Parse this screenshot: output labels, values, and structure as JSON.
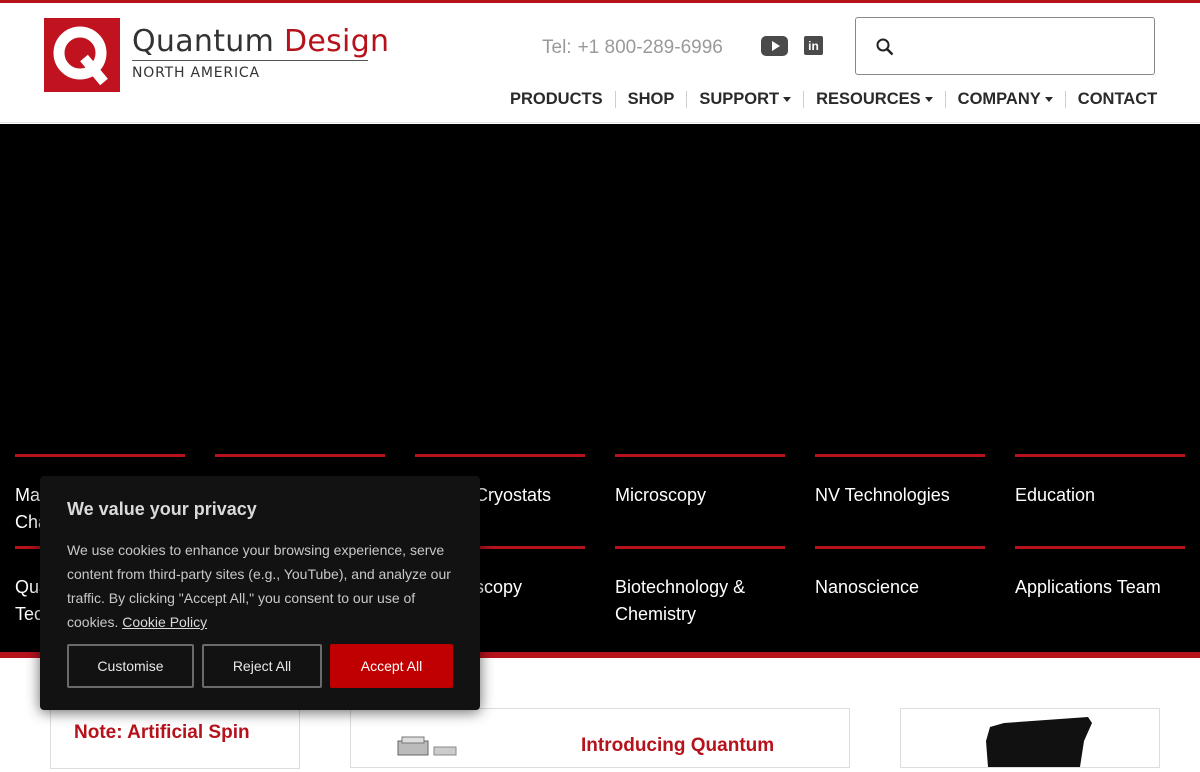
{
  "brand": {
    "name_part1": "Quantum",
    "name_part2": "Design",
    "region": "NORTH AMERICA",
    "color": "#b5121b"
  },
  "contact": {
    "tel_label": "Tel:",
    "tel_number": "+1 800-289-6996"
  },
  "social": [
    "youtube-icon",
    "linkedin-icon"
  ],
  "search": {
    "placeholder": "",
    "value": ""
  },
  "nav": {
    "products": "PRODUCTS",
    "shop": "SHOP",
    "support": "SUPPORT",
    "resources": "RESOURCES",
    "company": "COMPANY",
    "contact": "CONTACT"
  },
  "categories": {
    "row1": [
      "Ma\nCha",
      "",
      "Cryostats",
      "Microscopy",
      "NV Technologies",
      "Education"
    ],
    "row2": [
      "Qua\nTec",
      "",
      "scopy",
      "Biotechnology &\nChemistry",
      "Nanoscience",
      "Applications Team"
    ]
  },
  "cards": {
    "card1_title": "Note: Artificial Spin",
    "card2_title": "Introducing Quantum"
  },
  "cookie": {
    "title": "We value your privacy",
    "body": "We use cookies to enhance your browsing experience, serve content from third-party sites (e.g., YouTube), and analyze our traffic. By clicking \"Accept All,\" you consent to our use of cookies.",
    "policy_link": "Cookie Policy",
    "customise": "Customise",
    "reject": "Reject All",
    "accept": "Accept All"
  },
  "colors": {
    "accent": "#b5121b",
    "accept_button": "#c00000",
    "hero_bg": "#000000",
    "cookie_bg": "#121212"
  }
}
